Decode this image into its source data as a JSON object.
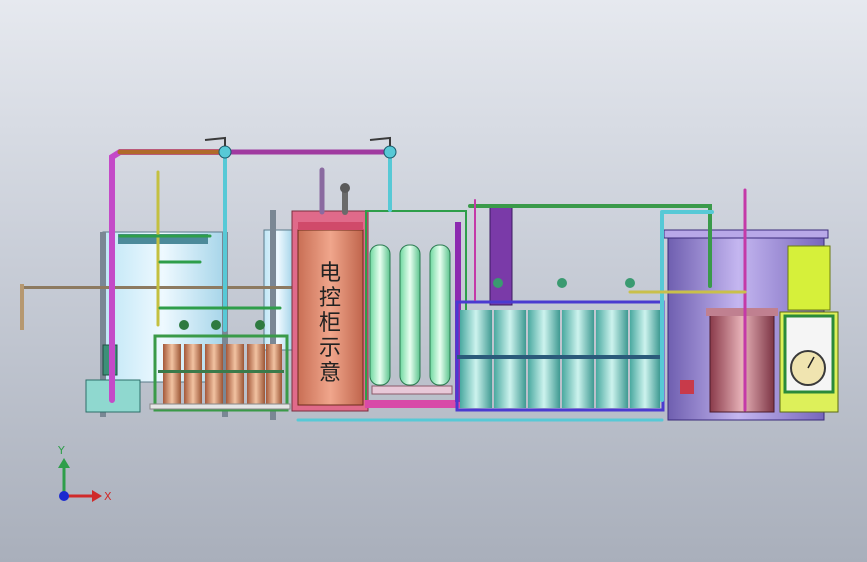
{
  "cabinet": {
    "label_chars": [
      "电",
      "控",
      "柜",
      "示",
      "意"
    ]
  },
  "triad": {
    "x_label": "X",
    "y_label": "Y"
  },
  "colors": {
    "background_top": "#e6e9ef",
    "background_bottom": "#a9afbb",
    "pipe_magenta": "#b23ad0",
    "pipe_green": "#2e9e4a",
    "pipe_brown": "#b06a2a",
    "pipe_cyan": "#57c9d6",
    "cabinet_fill": "#d88a72",
    "tank_purple": "#9b86d4",
    "filter_green": "#a8f0c8",
    "cartridge_orange": "#d4966a",
    "yellow_panel": "#c9e830"
  }
}
